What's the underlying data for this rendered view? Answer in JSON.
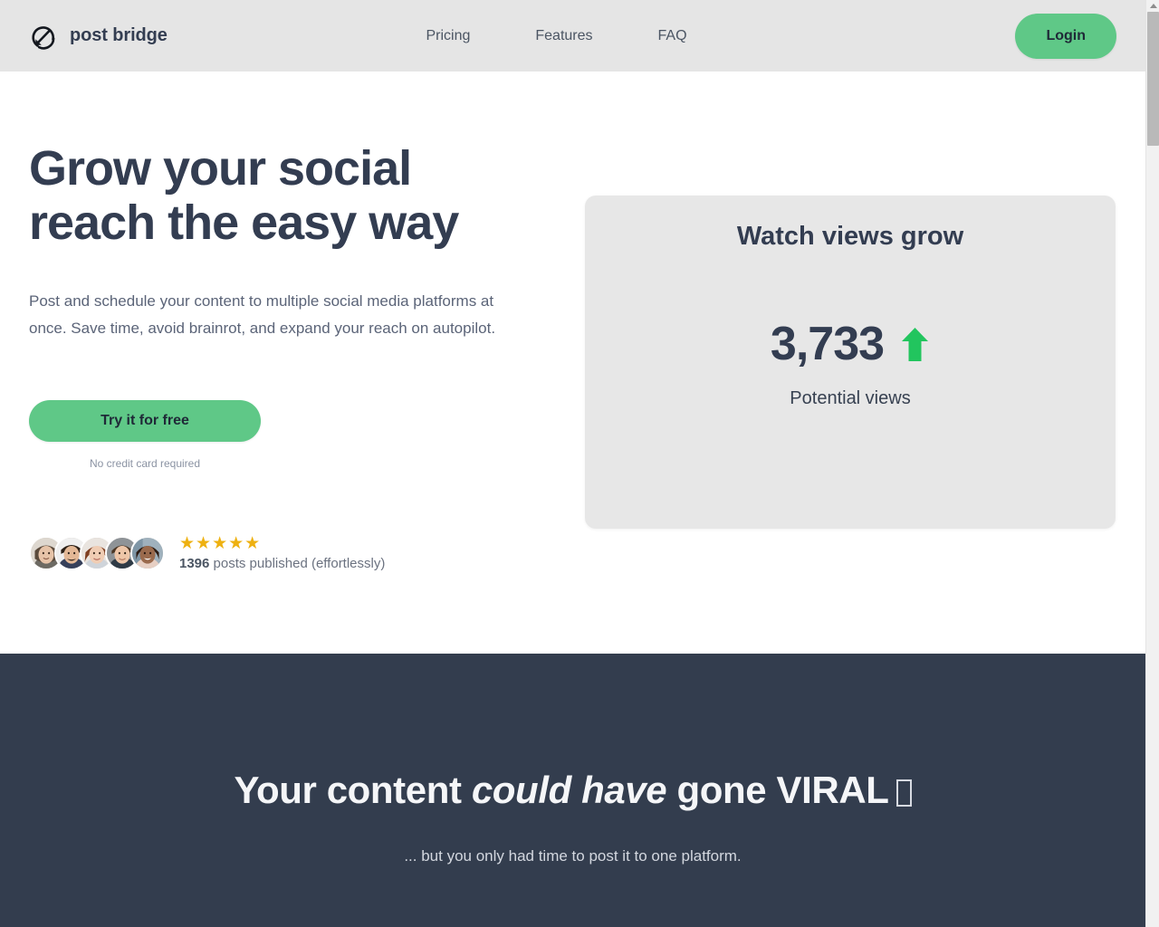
{
  "header": {
    "brand": {
      "name": "post bridge",
      "logo_icon": "circle-arrow-down-left-icon"
    },
    "nav": [
      {
        "label": "Pricing"
      },
      {
        "label": "Features"
      },
      {
        "label": "FAQ"
      }
    ],
    "login_label": "Login",
    "login_color": "#5fc887",
    "background_color": "#e5e5e5"
  },
  "hero": {
    "title_line1": "Grow your social",
    "title_line2": "reach the easy way",
    "subtitle": "Post and schedule your content to multiple social media platforms at once. Save time, avoid brainrot, and expand your reach on autopilot.",
    "cta_label": "Try it for free",
    "cta_note": "No credit card required",
    "cta_color": "#5fc887",
    "social_proof": {
      "avatar_count": 5,
      "stars": "★★★★★",
      "star_color": "#eeb111",
      "count": "1396",
      "count_suffix": " posts published (effortlessly)"
    }
  },
  "stat_card": {
    "title": "Watch views grow",
    "value": "3,733",
    "trend_icon": "arrow-up-icon",
    "trend_color": "#22c55e",
    "label": "Potential views",
    "background_color": "#e7e7e7"
  },
  "dark_section": {
    "title_part1": "Your content ",
    "title_emphasis": "could have",
    "title_part2": " gone VIRAL",
    "title_glyph": "missing-glyph-box",
    "subtitle": "... but you only had time to post it to one platform.",
    "background_color": "#333d4e"
  },
  "scrollbar": {
    "up_arrow_icon": "scroll-up-arrow-icon",
    "thumb_label": "vertical-scroll-thumb"
  }
}
